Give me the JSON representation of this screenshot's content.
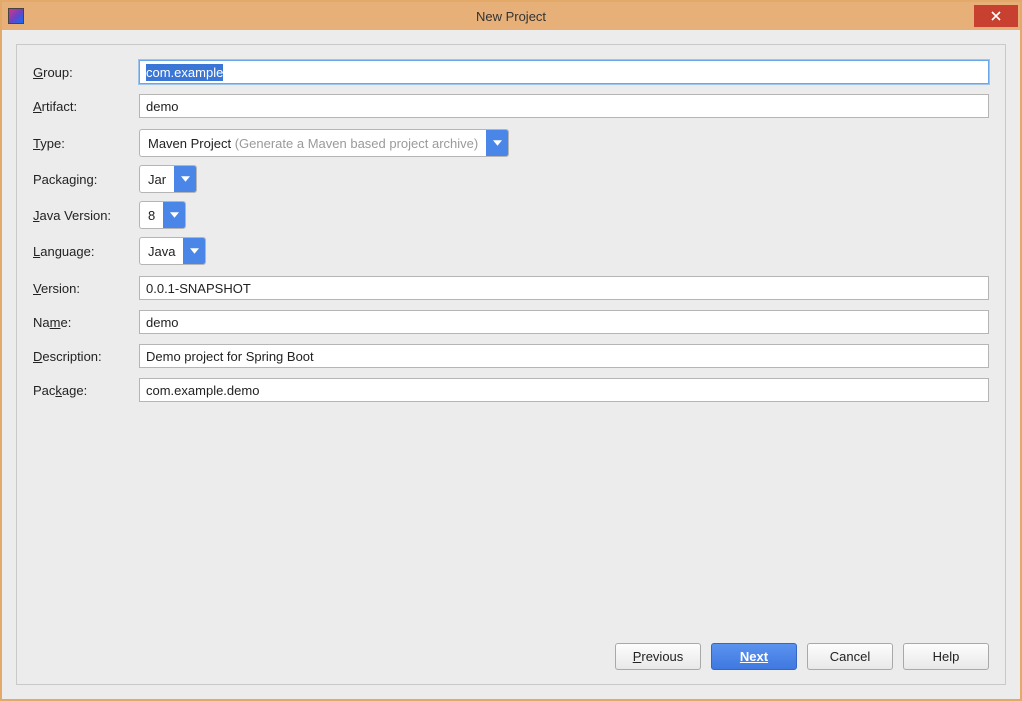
{
  "window": {
    "title": "New Project"
  },
  "labels": {
    "group": "Group:",
    "artifact": "Artifact:",
    "type": "Type:",
    "packaging": "Packaging:",
    "javaVersion": "Java Version:",
    "language": "Language:",
    "version": "Version:",
    "name": "Name:",
    "description": "Description:",
    "package": "Package:"
  },
  "fields": {
    "group": "com.example",
    "artifact": "demo",
    "type": {
      "value": "Maven Project",
      "hint": "(Generate a Maven based project archive)"
    },
    "packaging": "Jar",
    "javaVersion": "8",
    "language": "Java",
    "version": "0.0.1-SNAPSHOT",
    "name": "demo",
    "description": "Demo project for Spring Boot",
    "packageName": "com.example.demo"
  },
  "buttons": {
    "previous": "Previous",
    "next": "Next",
    "cancel": "Cancel",
    "help": "Help"
  }
}
